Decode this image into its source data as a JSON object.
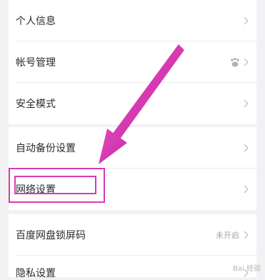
{
  "settings": {
    "items": [
      {
        "label": "个人信息",
        "value": ""
      },
      {
        "label": "帐号管理",
        "value": ""
      },
      {
        "label": "安全模式",
        "value": ""
      },
      {
        "label": "自动备份设置",
        "value": ""
      },
      {
        "label": "网络设置",
        "value": ""
      },
      {
        "label": "百度网盘锁屏码",
        "value": "未开启"
      },
      {
        "label": "隐私设置",
        "value": ""
      }
    ]
  },
  "annotation": {
    "color": "#d93ab6",
    "target": "网络设置"
  },
  "watermark": {
    "text": "Bai 经验"
  },
  "icons": {
    "chevron": "chevron-right-icon",
    "account_avatar": "paw-avatar-icon"
  }
}
